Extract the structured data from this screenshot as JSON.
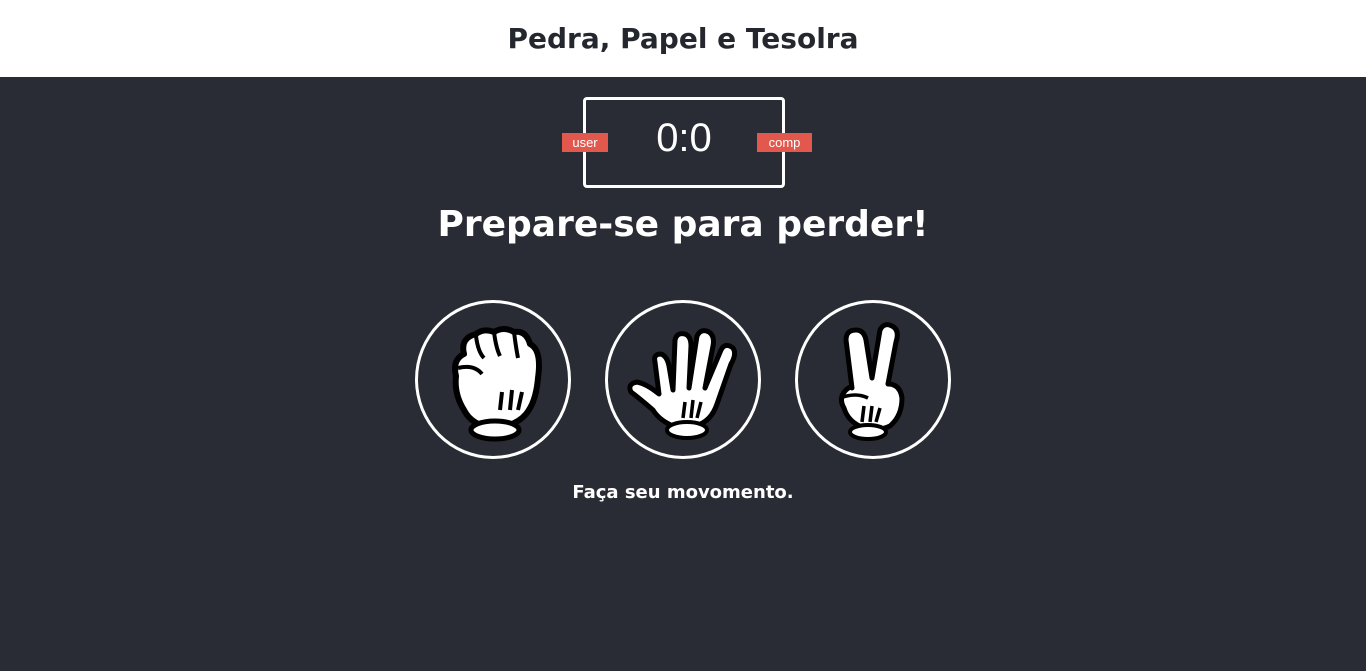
{
  "header": {
    "title": "Pedra, Papel e Tesolra"
  },
  "scoreboard": {
    "score": "0:0",
    "user_label": "user",
    "comp_label": "comp",
    "badge_color": "#e2584d"
  },
  "message": "Prepare-se para perder!",
  "choices": [
    {
      "icon": "rock-hand-icon"
    },
    {
      "icon": "paper-hand-icon"
    },
    {
      "icon": "scissors-hand-icon"
    }
  ],
  "action_message": "Faça seu movomento.",
  "colors": {
    "background": "#2a2c35",
    "header_bg": "#ffffff",
    "header_text": "#24272e"
  }
}
